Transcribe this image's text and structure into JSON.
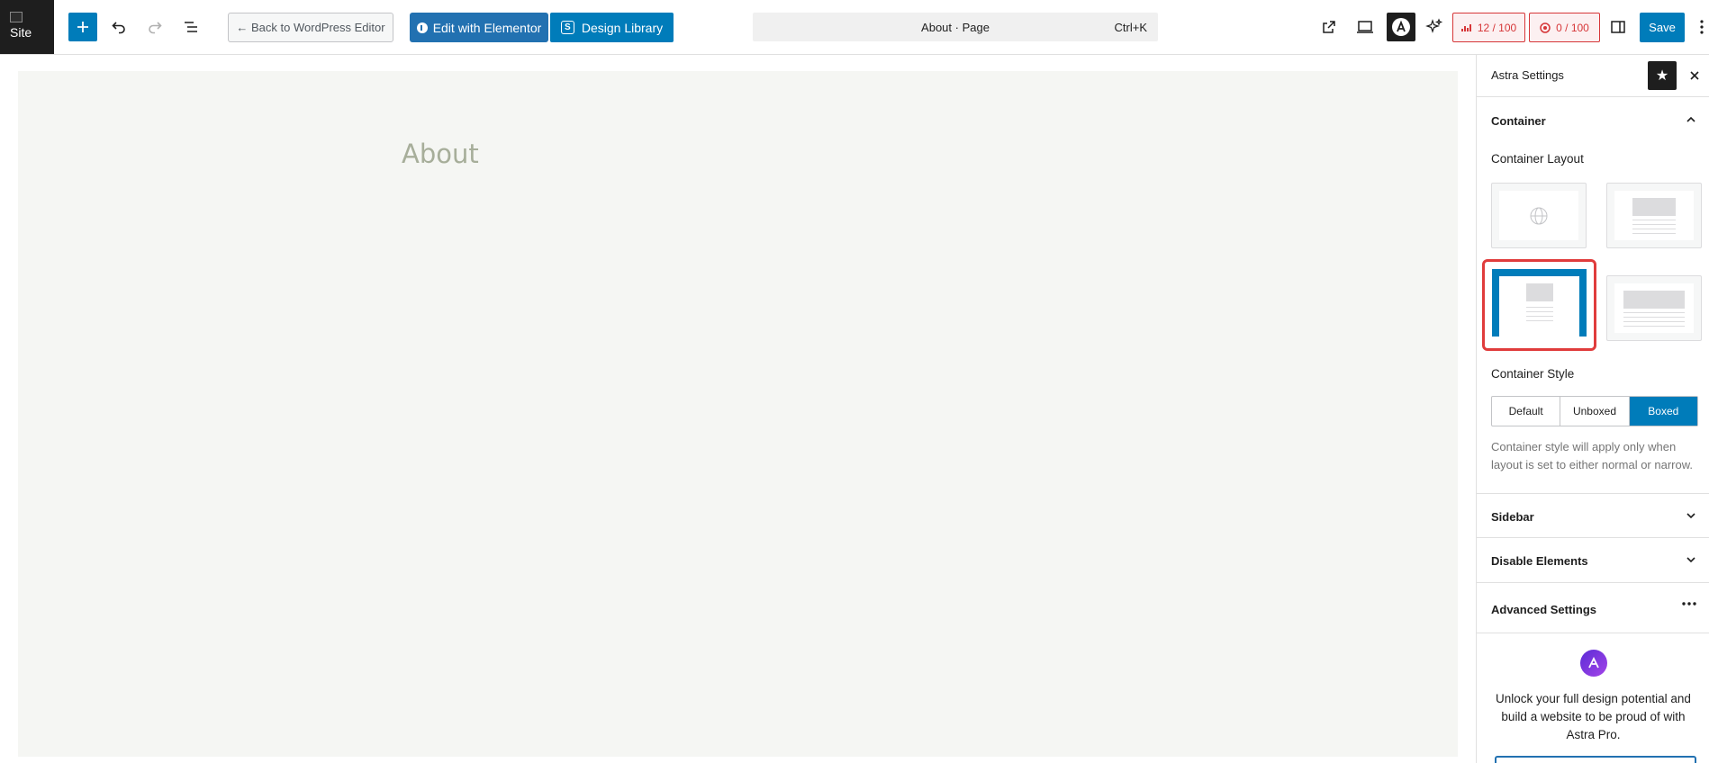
{
  "topbar": {
    "site_label": "Site",
    "back_label": "← Back to WordPress Editor",
    "elementor_label": "Edit with Elementor",
    "design_library_label": "Design Library",
    "command_title": "About · Page",
    "command_shortcut": "Ctrl+K",
    "seo_score": "12 / 100",
    "readability_score": "0 / 100",
    "save_label": "Save"
  },
  "canvas": {
    "page_title": "About"
  },
  "sidebar": {
    "title": "Astra Settings",
    "container_panel": {
      "label": "Container",
      "layout_label": "Container Layout",
      "layout_options": [
        "full-width-stretched",
        "narrow-width",
        "normal-width",
        "full-width-contained"
      ],
      "selected_layout": "normal-width",
      "style_label": "Container Style",
      "style_options": [
        "Default",
        "Unboxed",
        "Boxed"
      ],
      "selected_style": "Boxed",
      "help_text": "Container style will apply only when layout is set to either normal or narrow."
    },
    "panels": {
      "sidebar": "Sidebar",
      "disable_elements": "Disable Elements",
      "advanced_settings": "Advanced Settings"
    },
    "promo_text": "Unlock your full design potential and build a website to be proud of with Astra Pro."
  },
  "colors": {
    "accent": "#007cba",
    "highlight": "#e03c3c",
    "score_red": "#d63638"
  }
}
